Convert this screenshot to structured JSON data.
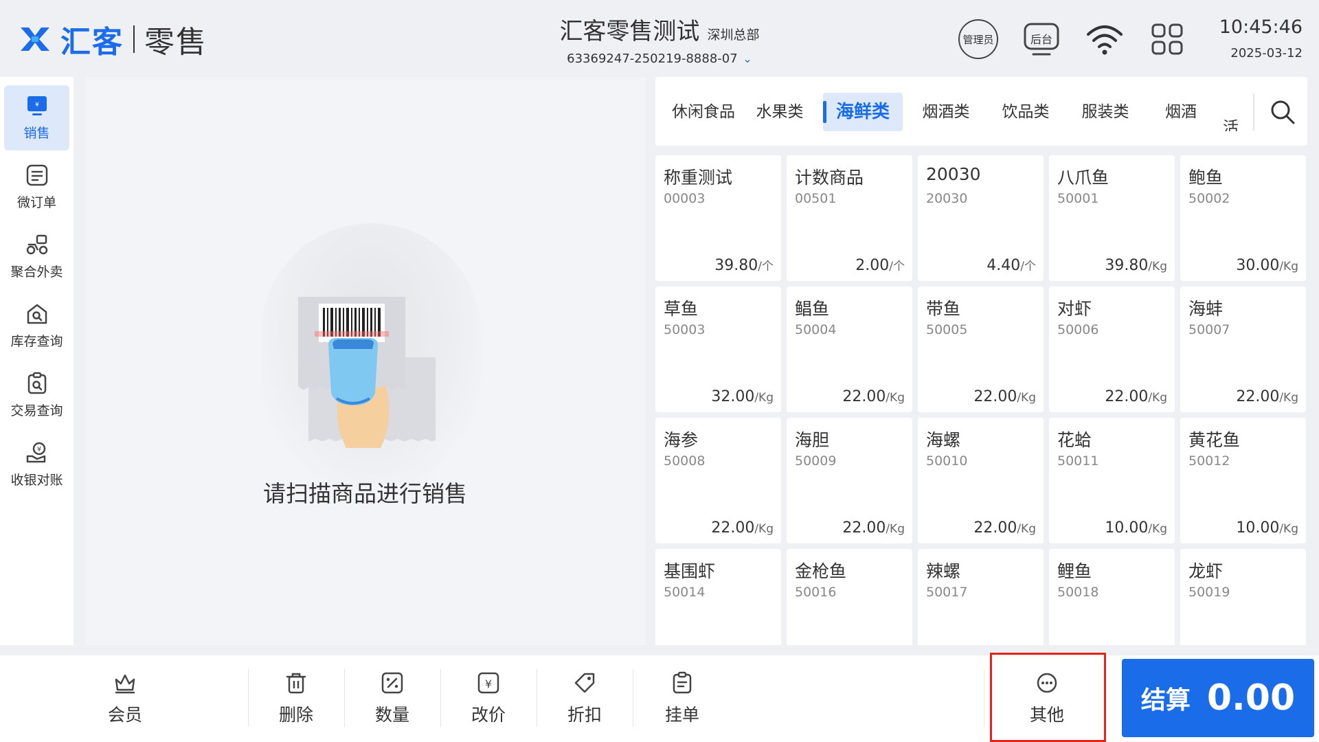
{
  "header": {
    "brand": "汇客",
    "brand_sub": "零售",
    "store_name": "汇客零售测试",
    "store_branch": "深圳总部",
    "store_code": "63369247-250219-8888-07",
    "admin_badge": "管理员",
    "backend_badge": "后台",
    "time": "10:45:46",
    "date": "2025-03-12"
  },
  "icons": {
    "brand_color": "#1a6ce8"
  },
  "sidebar": {
    "items": [
      {
        "label": "销售",
        "icon": "monitor-icon"
      },
      {
        "label": "微订单",
        "icon": "order-icon"
      },
      {
        "label": "聚合外卖",
        "icon": "delivery-scooter-icon"
      },
      {
        "label": "库存查询",
        "icon": "house-search-icon"
      },
      {
        "label": "交易查询",
        "icon": "clipboard-search-icon"
      },
      {
        "label": "收银对账",
        "icon": "cash-hand-icon"
      }
    ]
  },
  "scan": {
    "prompt": "请扫描商品进行销售"
  },
  "categories": {
    "tabs": [
      {
        "label": "休闲食品"
      },
      {
        "label": "水果类"
      },
      {
        "label": "海鲜类"
      },
      {
        "label": "烟酒类"
      },
      {
        "label": "饮品类"
      },
      {
        "label": "服装类"
      },
      {
        "label": "烟酒"
      },
      {
        "label": "活"
      }
    ],
    "active": "海鲜类"
  },
  "products": [
    {
      "name": "称重测试",
      "code": "00003",
      "price": "39.80",
      "unit": "/个"
    },
    {
      "name": "计数商品",
      "code": "00501",
      "price": "2.00",
      "unit": "/个"
    },
    {
      "name": "20030",
      "code": "20030",
      "price": "4.40",
      "unit": "/个"
    },
    {
      "name": "八爪鱼",
      "code": "50001",
      "price": "39.80",
      "unit": "/Kg"
    },
    {
      "name": "鲍鱼",
      "code": "50002",
      "price": "30.00",
      "unit": "/Kg"
    },
    {
      "name": "草鱼",
      "code": "50003",
      "price": "32.00",
      "unit": "/Kg"
    },
    {
      "name": "鲳鱼",
      "code": "50004",
      "price": "22.00",
      "unit": "/Kg"
    },
    {
      "name": "带鱼",
      "code": "50005",
      "price": "22.00",
      "unit": "/Kg"
    },
    {
      "name": "对虾",
      "code": "50006",
      "price": "22.00",
      "unit": "/Kg"
    },
    {
      "name": "海蚌",
      "code": "50007",
      "price": "22.00",
      "unit": "/Kg"
    },
    {
      "name": "海参",
      "code": "50008",
      "price": "22.00",
      "unit": "/Kg"
    },
    {
      "name": "海胆",
      "code": "50009",
      "price": "22.00",
      "unit": "/Kg"
    },
    {
      "name": "海螺",
      "code": "50010",
      "price": "22.00",
      "unit": "/Kg"
    },
    {
      "name": "花蛤",
      "code": "50011",
      "price": "10.00",
      "unit": "/Kg"
    },
    {
      "name": "黄花鱼",
      "code": "50012",
      "price": "10.00",
      "unit": "/Kg"
    },
    {
      "name": "基围虾",
      "code": "50014",
      "price": "",
      "unit": ""
    },
    {
      "name": "金枪鱼",
      "code": "50016",
      "price": "",
      "unit": ""
    },
    {
      "name": "辣螺",
      "code": "50017",
      "price": "",
      "unit": ""
    },
    {
      "name": "鲤鱼",
      "code": "50018",
      "price": "",
      "unit": ""
    },
    {
      "name": "龙虾",
      "code": "50019",
      "price": "",
      "unit": ""
    }
  ],
  "toolbar": {
    "member": "会员",
    "delete": "删除",
    "quantity": "数量",
    "change_price": "改价",
    "discount": "折扣",
    "hold": "挂单",
    "other": "其他",
    "checkout_label": "结算",
    "checkout_amount": "0.00"
  }
}
